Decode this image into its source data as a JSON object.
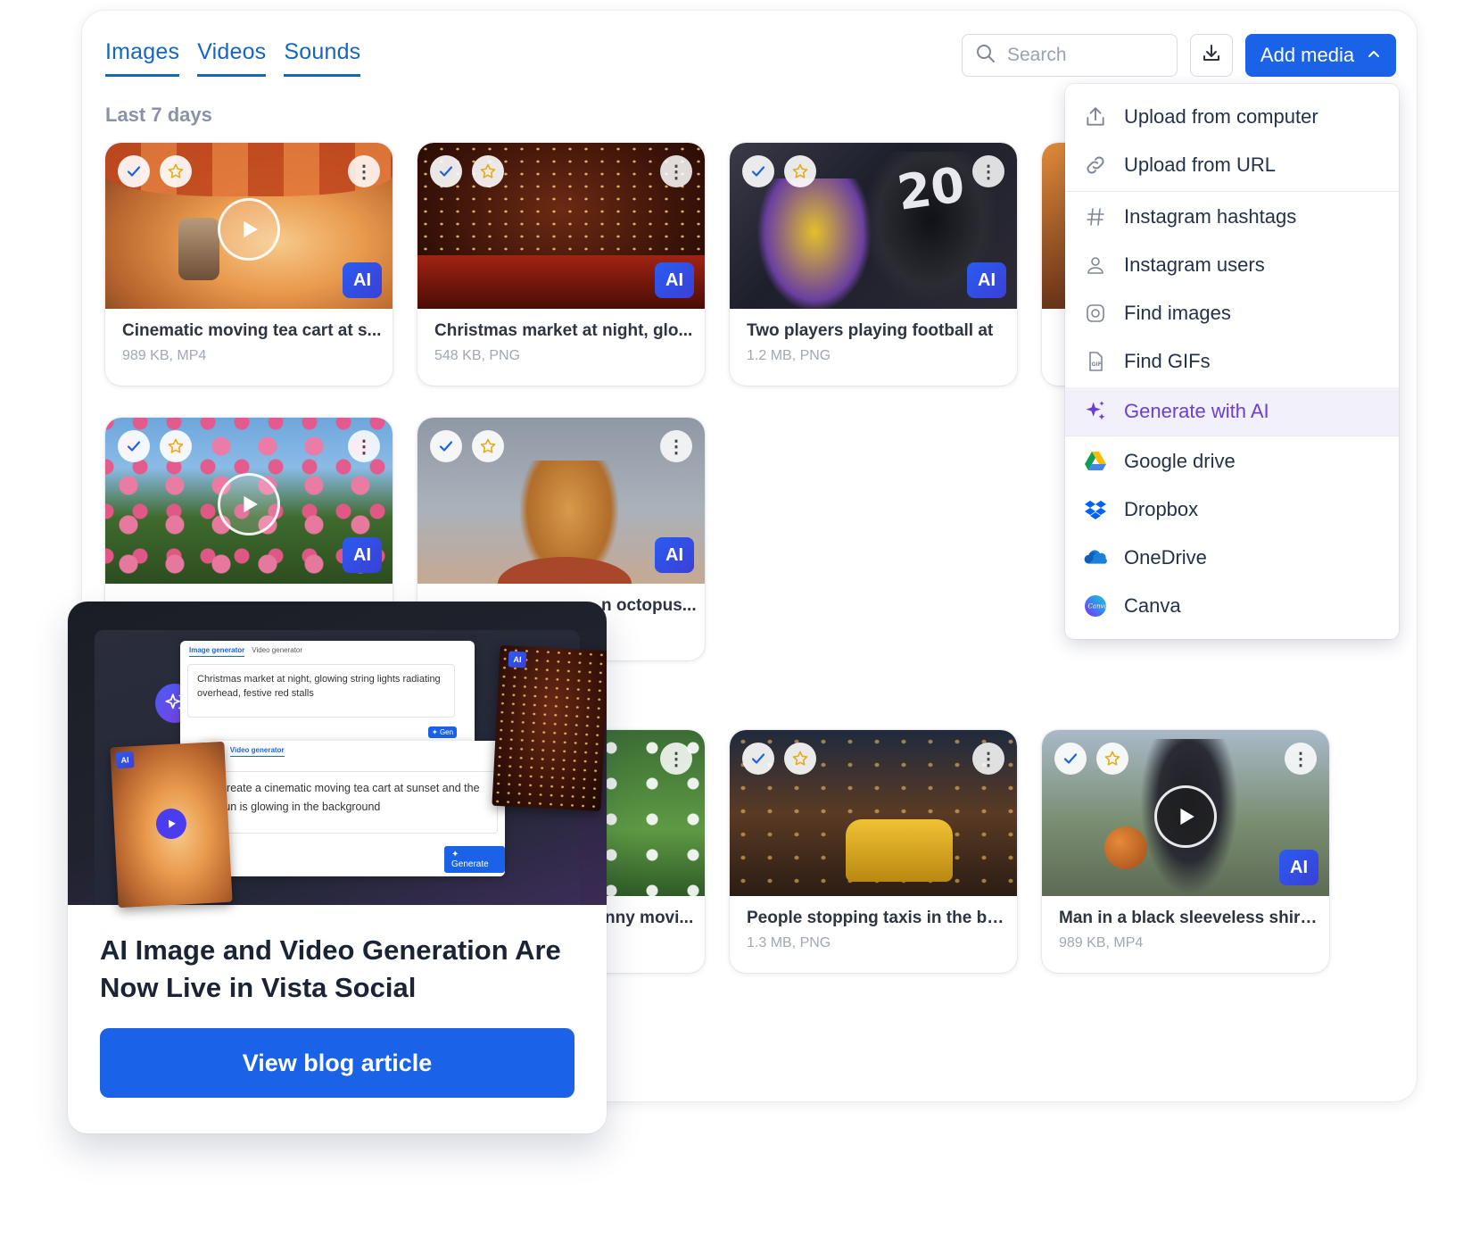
{
  "tabs": [
    {
      "label": "Images"
    },
    {
      "label": "Videos"
    },
    {
      "label": "Sounds"
    }
  ],
  "section_label": "Last 7 days",
  "search": {
    "placeholder": "Search"
  },
  "add_media": {
    "label": "Add media"
  },
  "cards": [
    {
      "title": "Cinematic moving tea cart at s...",
      "meta": "989 KB, MP4",
      "ai": "AI"
    },
    {
      "title": "Christmas market at night, glo...",
      "meta": "548 KB, PNG",
      "ai": "AI"
    },
    {
      "title": "Two players playing football at",
      "meta": "1.2 MB, PNG",
      "ai": "AI"
    },
    {
      "title": "",
      "meta": "",
      "ai": "AI"
    },
    {
      "title": "n octopus...",
      "meta": "",
      "ai": "AI"
    },
    {
      "title": "nny movi...",
      "meta": ""
    },
    {
      "title": "People stopping taxis in the bu...",
      "meta": "1.3 MB, PNG"
    },
    {
      "title": "Man in a black sleeveless shirt...",
      "meta": "989 KB, MP4",
      "ai": "AI"
    }
  ],
  "dropdown": [
    {
      "label": "Upload from computer",
      "icon": "upload-icon"
    },
    {
      "label": "Upload from URL",
      "icon": "link-icon"
    },
    {
      "label": "Instagram hashtags",
      "icon": "hashtag-icon"
    },
    {
      "label": "Instagram users",
      "icon": "user-icon"
    },
    {
      "label": "Find images",
      "icon": "camera-icon"
    },
    {
      "label": "Find GIFs",
      "icon": "gif-icon"
    },
    {
      "label": "Generate with AI",
      "icon": "sparkle-icon"
    },
    {
      "label": "Google drive",
      "icon": "google-drive-icon"
    },
    {
      "label": "Dropbox",
      "icon": "dropbox-icon"
    },
    {
      "label": "OneDrive",
      "icon": "onedrive-icon"
    },
    {
      "label": "Canva",
      "icon": "canva-icon"
    }
  ],
  "promo": {
    "title": "AI Image and Video Generation Are Now Live in Vista Social",
    "button": "View blog article",
    "mini": {
      "tab_image": "Image generator",
      "tab_video": "Video generator",
      "tab_partial": "ator",
      "prompt_image": "Christmas market at night, glowing string lights radiating overhead, festive red stalls",
      "prompt_video": "Create a cinematic moving tea cart at sunset and the sun is glowing in the background",
      "generate": "Generate",
      "generate_partial": "Gen",
      "ai": "AI"
    }
  },
  "colors": {
    "accent": "#1a63e8",
    "tab": "#1566c0",
    "ai_purple": "#6a3fd3"
  }
}
